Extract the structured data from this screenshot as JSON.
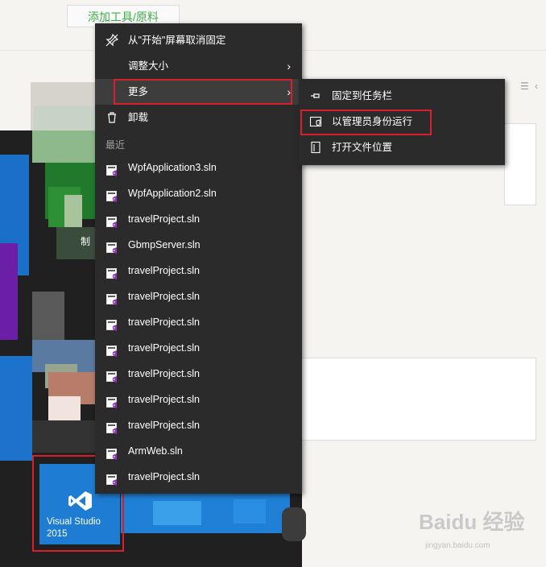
{
  "page": {
    "top_button_label": "添加工具/原料",
    "start_pixel_label": "制"
  },
  "menu": {
    "items": [
      {
        "label": "从\"开始\"屏幕取消固定",
        "icon": "unpin-icon"
      },
      {
        "label": "调整大小",
        "icon": "none",
        "arrow": "›"
      },
      {
        "label": "更多",
        "icon": "none",
        "arrow": "›"
      },
      {
        "label": "卸载",
        "icon": "trash-icon"
      }
    ],
    "recent_header": "最近",
    "recent": [
      "WpfApplication3.sln",
      "WpfApplication2.sln",
      "travelProject.sln",
      "GbmpServer.sln",
      "travelProject.sln",
      "travelProject.sln",
      "travelProject.sln",
      "travelProject.sln",
      "travelProject.sln",
      "travelProject.sln",
      "travelProject.sln",
      "ArmWeb.sln",
      "travelProject.sln"
    ]
  },
  "submenu": {
    "items": [
      {
        "label": "固定到任务栏",
        "icon": "pin-icon"
      },
      {
        "label": "以管理员身份运行",
        "icon": "admin-shield-icon"
      },
      {
        "label": "打开文件位置",
        "icon": "file-location-icon"
      }
    ]
  },
  "tile": {
    "name_line1": "Visual Studio",
    "name_line2": "2015",
    "color": "#1e7cd2"
  },
  "watermark": {
    "logo": "Baidu 经验",
    "url": "jingyan.baidu.com"
  },
  "colors": {
    "menu_bg": "#2b2b2b",
    "highlight_border": "#d9202a",
    "accent_green": "#3fae49"
  }
}
